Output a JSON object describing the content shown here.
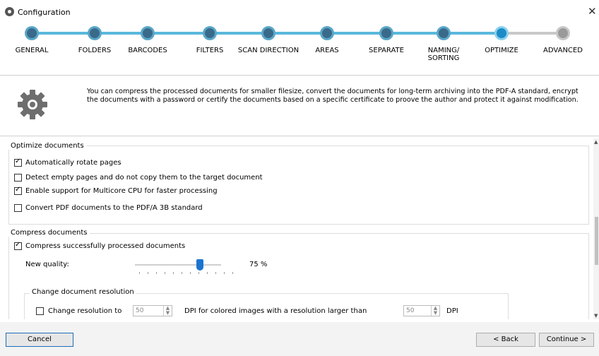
{
  "window": {
    "title": "Configuration",
    "close_glyph": "✕"
  },
  "steps": [
    {
      "label": "GENERAL",
      "state": "done"
    },
    {
      "label": "FOLDERS",
      "state": "done"
    },
    {
      "label": "BARCODES",
      "state": "done"
    },
    {
      "label": "FILTERS",
      "state": "done"
    },
    {
      "label": "SCAN DIRECTION",
      "state": "done"
    },
    {
      "label": "AREAS",
      "state": "done"
    },
    {
      "label": "SEPARATE",
      "state": "done"
    },
    {
      "label": "NAMING/ SORTING",
      "state": "done"
    },
    {
      "label": "OPTIMIZE",
      "state": "current"
    },
    {
      "label": "ADVANCED",
      "state": "todo"
    }
  ],
  "description": "You can compress the processed documents for smaller filesize, convert the documents for long-term archiving into the PDF-A standard, encrypt the documents with a password or certify the documents based on a specific certificate to proove the author and protect it against modification.",
  "optimize_group": {
    "title": "Optimize documents",
    "options": [
      {
        "label": "Automatically rotate pages",
        "checked": true
      },
      {
        "label": "Detect empty pages and do not copy them to the target document",
        "checked": false
      },
      {
        "label": "Enable support for Multicore CPU for faster processing",
        "checked": true
      },
      {
        "label": "Convert PDF documents to the PDF/A 3B standard",
        "checked": false
      }
    ]
  },
  "compress_group": {
    "title": "Compress documents",
    "compress_label": "Compress successfully processed documents",
    "compress_checked": true,
    "quality_label": "New quality:",
    "quality_value": 75,
    "quality_text": "75 %",
    "resolution_group": {
      "title": "Change document resolution",
      "change_label": "Change resolution to",
      "change_checked": false,
      "resolution_value": "50",
      "middle_text": "DPI for colored images with a resolution larger than",
      "threshold_value": "50",
      "unit": "DPI"
    }
  },
  "buttons": {
    "cancel": "Cancel",
    "back": "< Back",
    "continue": "Continue >"
  },
  "colors": {
    "accent": "#1c8cc7",
    "track": "#5bb8dc",
    "thumb": "#1b74d0"
  }
}
